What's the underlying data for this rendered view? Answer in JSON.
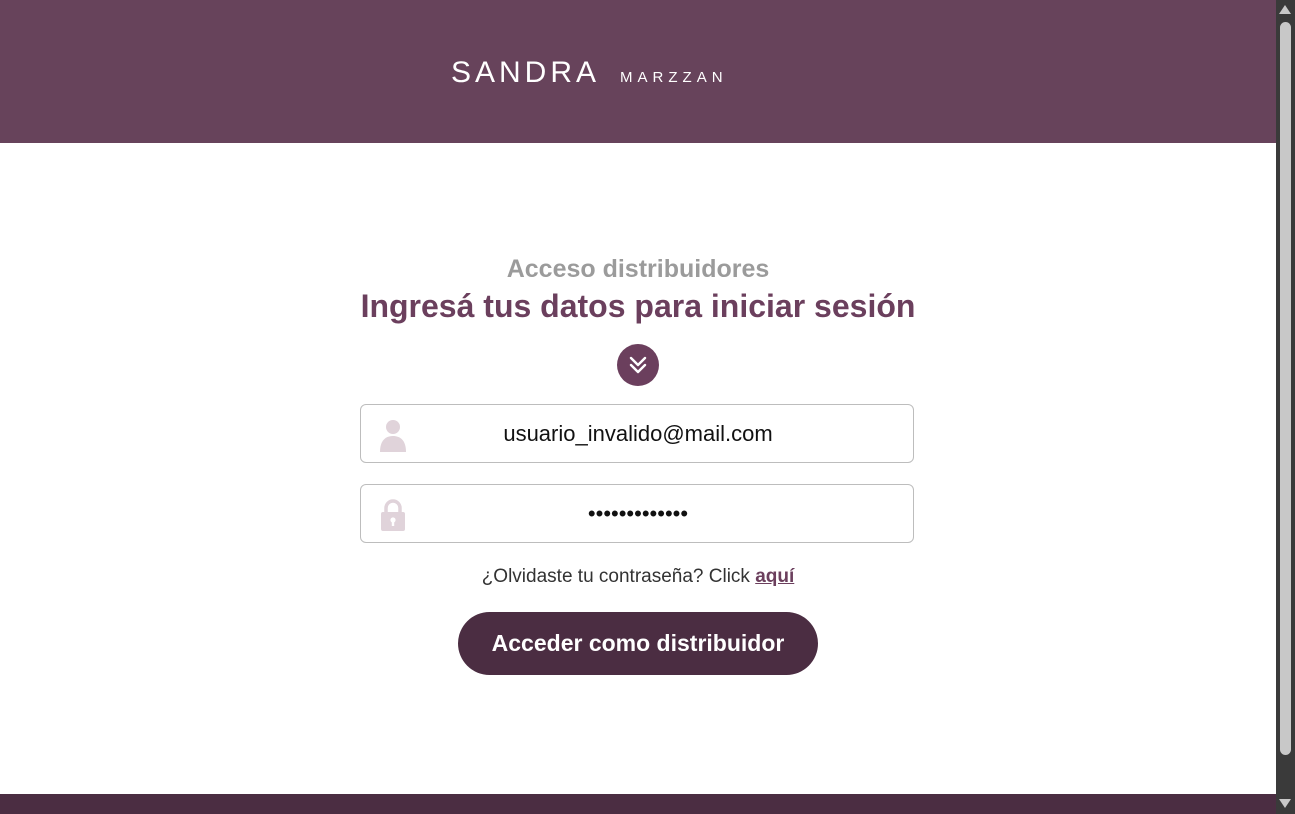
{
  "header": {
    "logo_main": "SANDRA",
    "logo_sub": "MARZZAN",
    "background_color": "#67435b"
  },
  "login": {
    "subtitle": "Acceso distribuidores",
    "title": "Ingresá tus datos para iniciar sesión",
    "badge_icon": "double-chevron-down-icon",
    "email": {
      "icon": "user-icon",
      "value": "usuario_invalido@mail.com"
    },
    "password": {
      "icon": "lock-icon",
      "value": "passwordvalue"
    },
    "forgot_text": "¿Olvidaste tu contraseña? Click",
    "forgot_link": "aquí",
    "submit_label": "Acceder como distribuidor"
  },
  "colors": {
    "accent": "#6b3f5d",
    "button": "#4b2d42",
    "icon_muted": "#e0d3da",
    "subtitle_gray": "#9b9b9b"
  }
}
